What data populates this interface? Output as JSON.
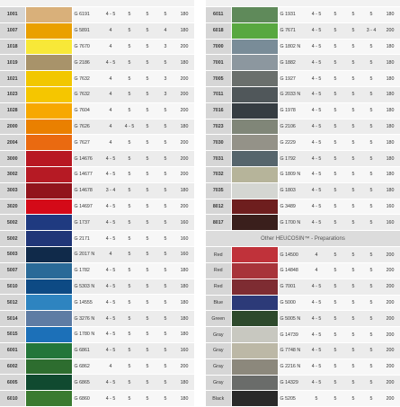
{
  "left_rows": [
    {
      "code": "1001",
      "color": "#d9b07a",
      "g": "G 6191",
      "a": "4 - 5",
      "b": "5",
      "c": "5",
      "d": "5",
      "e": "180"
    },
    {
      "code": "1007",
      "color": "#eaa000",
      "g": "G 5891",
      "a": "4",
      "b": "5",
      "c": "5",
      "d": "4",
      "e": "180"
    },
    {
      "code": "1018",
      "color": "#f8e838",
      "g": "G 7670",
      "a": "4",
      "b": "5",
      "c": "5",
      "d": "3",
      "e": "200"
    },
    {
      "code": "1019",
      "color": "#a8936a",
      "g": "G 2186",
      "a": "4 - 5",
      "b": "5",
      "c": "5",
      "d": "5",
      "e": "180"
    },
    {
      "code": "1021",
      "color": "#f2c700",
      "g": "G 7632",
      "a": "4",
      "b": "5",
      "c": "5",
      "d": "3",
      "e": "200"
    },
    {
      "code": "1023",
      "color": "#f5c600",
      "g": "G 7632",
      "a": "4",
      "b": "5",
      "c": "5",
      "d": "3",
      "e": "200"
    },
    {
      "code": "1028",
      "color": "#f7a800",
      "g": "G 7604",
      "a": "4",
      "b": "5",
      "c": "5",
      "d": "5",
      "e": "200"
    },
    {
      "code": "2000",
      "color": "#ea8000",
      "g": "G 7626",
      "a": "4",
      "b": "4 - 5",
      "c": "5",
      "d": "5",
      "e": "180"
    },
    {
      "code": "2004",
      "color": "#ea6a10",
      "g": "G 7627",
      "a": "4",
      "b": "5",
      "c": "5",
      "d": "5",
      "e": "200"
    },
    {
      "code": "3000",
      "color": "#b81822",
      "g": "G 14676",
      "a": "4 - 5",
      "b": "5",
      "c": "5",
      "d": "5",
      "e": "200"
    },
    {
      "code": "3002",
      "color": "#b61a24",
      "g": "G 14677",
      "a": "4 - 5",
      "b": "5",
      "c": "5",
      "d": "5",
      "e": "200"
    },
    {
      "code": "3003",
      "color": "#92141c",
      "g": "G 14678",
      "a": "3 - 4",
      "b": "5",
      "c": "5",
      "d": "5",
      "e": "180"
    },
    {
      "code": "3020",
      "color": "#d40a18",
      "g": "G 14697",
      "a": "4 - 5",
      "b": "5",
      "c": "5",
      "d": "5",
      "e": "200"
    },
    {
      "code": "5002",
      "color": "#1f3a80",
      "g": "G 1737",
      "a": "4 - 5",
      "b": "5",
      "c": "5",
      "d": "5",
      "e": "160"
    },
    {
      "code": "5002",
      "color": "#203678",
      "g": "G 2171",
      "a": "4 - 5",
      "b": "5",
      "c": "5",
      "d": "5",
      "e": "160"
    },
    {
      "code": "5003",
      "color": "#102a4a",
      "g": "G 2017 N",
      "a": "4",
      "b": "5",
      "c": "5",
      "d": "5",
      "e": "160"
    },
    {
      "code": "5007",
      "color": "#2a6a98",
      "g": "G 1782",
      "a": "4 - 5",
      "b": "5",
      "c": "5",
      "d": "5",
      "e": "180"
    },
    {
      "code": "5010",
      "color": "#0d4a84",
      "g": "G 5303 N",
      "a": "4 - 5",
      "b": "5",
      "c": "5",
      "d": "5",
      "e": "180"
    },
    {
      "code": "5012",
      "color": "#2e84c0",
      "g": "G 14555",
      "a": "4 - 5",
      "b": "5",
      "c": "5",
      "d": "5",
      "e": "180"
    },
    {
      "code": "5014",
      "color": "#5e7ca4",
      "g": "G 3276 N",
      "a": "4 - 5",
      "b": "5",
      "c": "5",
      "d": "5",
      "e": "180"
    },
    {
      "code": "5015",
      "color": "#1c70b8",
      "g": "G 1780 N",
      "a": "4 - 5",
      "b": "5",
      "c": "5",
      "d": "5",
      "e": "180"
    },
    {
      "code": "6001",
      "color": "#23763a",
      "g": "G 6861",
      "a": "4 - 5",
      "b": "5",
      "c": "5",
      "d": "5",
      "e": "160"
    },
    {
      "code": "6002",
      "color": "#2d6d2f",
      "g": "G 6862",
      "a": "4",
      "b": "5",
      "c": "5",
      "d": "5",
      "e": "200"
    },
    {
      "code": "6005",
      "color": "#104a30",
      "g": "G 6865",
      "a": "4 - 5",
      "b": "5",
      "c": "5",
      "d": "5",
      "e": "180"
    },
    {
      "code": "6010",
      "color": "#3a7a30",
      "g": "G 6860",
      "a": "4 - 5",
      "b": "5",
      "c": "5",
      "d": "5",
      "e": "180"
    }
  ],
  "right_rows": [
    {
      "code": "6011",
      "color": "#5f8a5a",
      "g": "G 1931",
      "a": "4 - 5",
      "b": "5",
      "c": "5",
      "d": "5",
      "e": "180"
    },
    {
      "code": "6018",
      "color": "#58a840",
      "g": "G 7671",
      "a": "4 - 5",
      "b": "5",
      "c": "5",
      "d": "3 - 4",
      "e": "200"
    },
    {
      "code": "7000",
      "color": "#798c98",
      "g": "G 1802 N",
      "a": "4 - 5",
      "b": "5",
      "c": "5",
      "d": "5",
      "e": "180"
    },
    {
      "code": "7001",
      "color": "#8c979f",
      "g": "G 1882",
      "a": "4 - 5",
      "b": "5",
      "c": "5",
      "d": "5",
      "e": "180"
    },
    {
      "code": "7005",
      "color": "#6a6f6c",
      "g": "G 1927",
      "a": "4 - 5",
      "b": "5",
      "c": "5",
      "d": "5",
      "e": "180"
    },
    {
      "code": "7011",
      "color": "#50575a",
      "g": "G 2033 N",
      "a": "4 - 5",
      "b": "5",
      "c": "5",
      "d": "5",
      "e": "180"
    },
    {
      "code": "7016",
      "color": "#363d42",
      "g": "G 1978",
      "a": "4 - 5",
      "b": "5",
      "c": "5",
      "d": "5",
      "e": "180"
    },
    {
      "code": "7023",
      "color": "#808678",
      "g": "G 2106",
      "a": "4 - 5",
      "b": "5",
      "c": "5",
      "d": "5",
      "e": "180"
    },
    {
      "code": "7030",
      "color": "#949288",
      "g": "G 2229",
      "a": "4 - 5",
      "b": "5",
      "c": "5",
      "d": "5",
      "e": "180"
    },
    {
      "code": "7031",
      "color": "#56656c",
      "g": "G 1792",
      "a": "4 - 5",
      "b": "5",
      "c": "5",
      "d": "5",
      "e": "180"
    },
    {
      "code": "7032",
      "color": "#b6b49a",
      "g": "G 1809 N",
      "a": "4 - 5",
      "b": "5",
      "c": "5",
      "d": "5",
      "e": "180"
    },
    {
      "code": "7035",
      "color": "#d4d6d2",
      "g": "G 1803",
      "a": "4 - 5",
      "b": "5",
      "c": "5",
      "d": "5",
      "e": "180"
    },
    {
      "code": "8012",
      "color": "#6e1e1e",
      "g": "G 3489",
      "a": "4 - 5",
      "b": "5",
      "c": "5",
      "d": "5",
      "e": "160"
    },
    {
      "code": "8017",
      "color": "#3a1f1c",
      "g": "G 1700 N",
      "a": "4 - 5",
      "b": "5",
      "c": "5",
      "d": "5",
      "e": "160"
    }
  ],
  "section_title": "Other HEUCOSIN™ - Preparations",
  "prep_rows": [
    {
      "code": "Red",
      "color": "#c0323a",
      "g": "G 14500",
      "a": "4",
      "b": "5",
      "c": "5",
      "d": "5",
      "e": "200"
    },
    {
      "code": "Red",
      "color": "#a8343a",
      "g": "G 14848",
      "a": "4",
      "b": "5",
      "c": "5",
      "d": "5",
      "e": "200"
    },
    {
      "code": "Red",
      "color": "#7e2c32",
      "g": "G 7001",
      "a": "4 - 5",
      "b": "5",
      "c": "5",
      "d": "5",
      "e": "200"
    },
    {
      "code": "Blue",
      "color": "#2c3a78",
      "g": "G 5000",
      "a": "4 - 5",
      "b": "5",
      "c": "5",
      "d": "5",
      "e": "200"
    },
    {
      "code": "Green",
      "color": "#2e4a2c",
      "g": "G 5005 N",
      "a": "4 - 5",
      "b": "5",
      "c": "5",
      "d": "5",
      "e": "200"
    },
    {
      "code": "Gray",
      "color": "#c8c8c0",
      "g": "G 14739",
      "a": "4 - 5",
      "b": "5",
      "c": "5",
      "d": "5",
      "e": "200"
    },
    {
      "code": "Gray",
      "color": "#bcb8a6",
      "g": "G 7748 N",
      "a": "4 - 5",
      "b": "5",
      "c": "5",
      "d": "5",
      "e": "200"
    },
    {
      "code": "Gray",
      "color": "#8c887c",
      "g": "G 2216 N",
      "a": "4 - 5",
      "b": "5",
      "c": "5",
      "d": "5",
      "e": "200"
    },
    {
      "code": "Gray",
      "color": "#6a6c6a",
      "g": "G 14329",
      "a": "4 - 5",
      "b": "5",
      "c": "5",
      "d": "5",
      "e": "200"
    },
    {
      "code": "Black",
      "color": "#2a2a2a",
      "g": "G 5205",
      "a": "5",
      "b": "5",
      "c": "5",
      "d": "5",
      "e": "200"
    }
  ]
}
